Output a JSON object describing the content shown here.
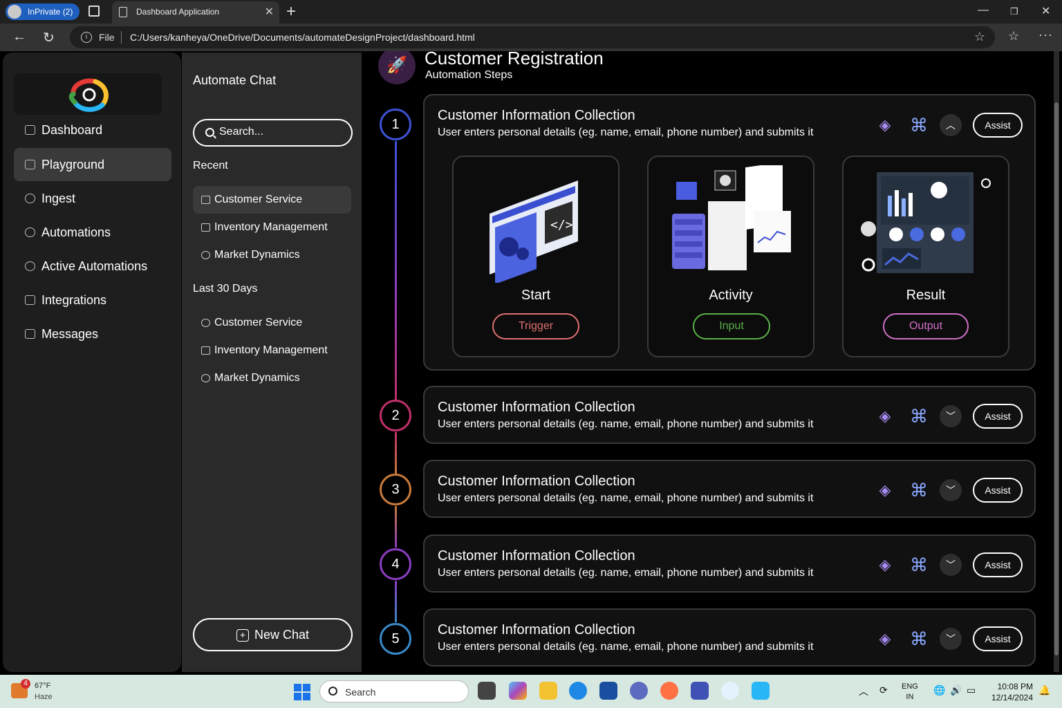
{
  "browser": {
    "inprivate_label": "InPrivate (2)",
    "tab_title": "Dashboard Application",
    "file_label": "File",
    "url": "C:/Users/kanheya/OneDrive/Documents/automateDesignProject/dashboard.html"
  },
  "sidebar": {
    "items": [
      {
        "label": "Dashboard",
        "icon": "chart-icon"
      },
      {
        "label": "Playground",
        "icon": "playground-icon",
        "active": true
      },
      {
        "label": "Ingest",
        "icon": "cloud-icon"
      },
      {
        "label": "Automations",
        "icon": "gear-icon"
      },
      {
        "label": "Active Automations",
        "icon": "cycle-icon"
      },
      {
        "label": "Integrations",
        "icon": "integration-icon"
      },
      {
        "label": "Messages",
        "icon": "message-icon"
      }
    ]
  },
  "chat": {
    "title": "Automate Chat",
    "search_placeholder": "Search...",
    "recent_label": "Recent",
    "recent": [
      "Customer Service",
      "Inventory Management",
      "Market Dynamics"
    ],
    "last30_label": "Last 30 Days",
    "last30": [
      "Customer Service",
      "Inventory Management",
      "Market Dynamics"
    ],
    "new_chat_label": "New Chat"
  },
  "main": {
    "title": "Customer Registration",
    "subtitle": "Automation Steps",
    "steps": [
      {
        "num": "1",
        "title": "Customer Information Collection",
        "desc": "User enters personal details (eg. name, email, phone number) and submits it",
        "assist": "Assist",
        "expanded": true,
        "color": "#3d52d5"
      },
      {
        "num": "2",
        "title": "Customer Information Collection",
        "desc": "User enters personal details (eg. name, email, phone number) and submits it",
        "assist": "Assist",
        "color": "#c0306a"
      },
      {
        "num": "3",
        "title": "Customer Information Collection",
        "desc": "User enters personal details (eg. name, email, phone number) and submits it",
        "assist": "Assist",
        "color": "#c87a3a"
      },
      {
        "num": "4",
        "title": "Customer Information Collection",
        "desc": "User enters personal details (eg. name, email, phone number) and submits it",
        "assist": "Assist",
        "color": "#8a3ec0"
      },
      {
        "num": "5",
        "title": "Customer Information Collection",
        "desc": "User enters personal details (eg. name, email, phone number) and submits it",
        "assist": "Assist",
        "color": "#3a8ac8"
      }
    ],
    "cards": [
      {
        "label": "Start",
        "button": "Trigger",
        "color": "#e07070"
      },
      {
        "label": "Activity",
        "button": "Input",
        "color": "#5ab04a"
      },
      {
        "label": "Result",
        "button": "Output",
        "color": "#d070c8"
      }
    ]
  },
  "taskbar": {
    "weather_temp": "67°F",
    "weather_desc": "Haze",
    "weather_badge": "4",
    "search_label": "Search",
    "lang_line1": "ENG",
    "lang_line2": "IN",
    "time": "10:08 PM",
    "date": "12/14/2024"
  }
}
